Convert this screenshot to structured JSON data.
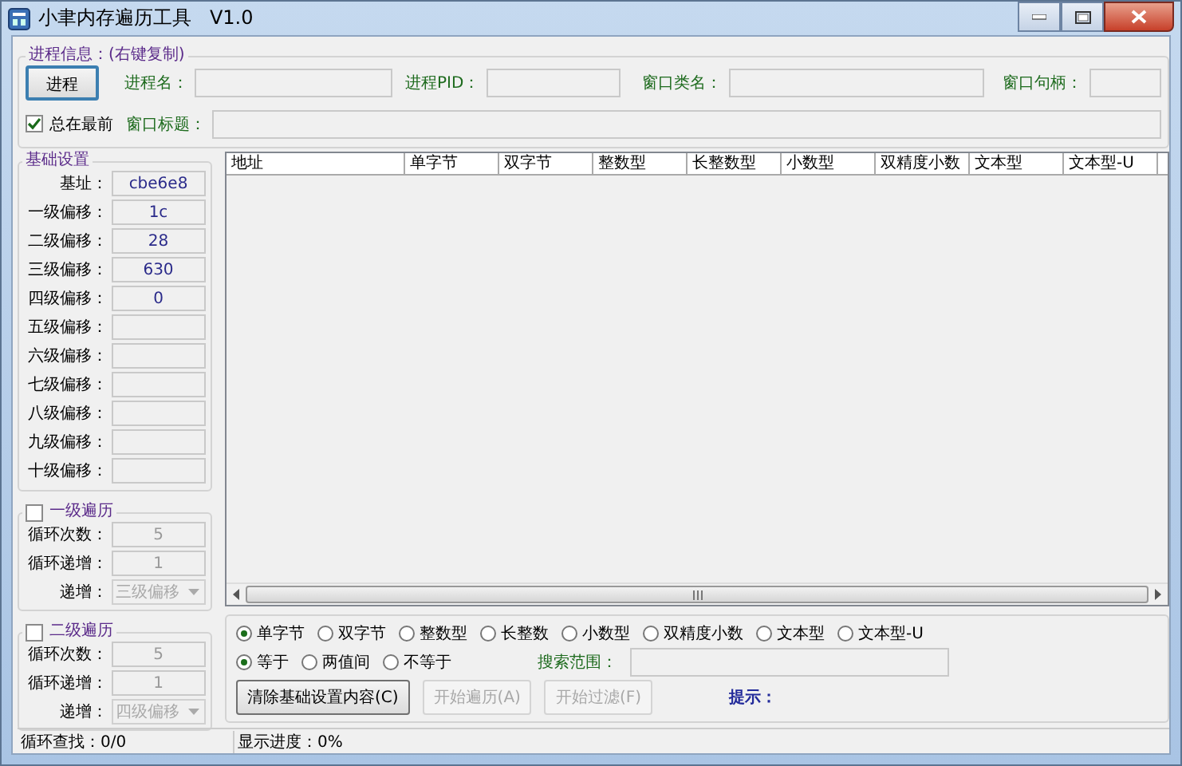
{
  "window": {
    "title": "小聿内存遍历工具   V1.0"
  },
  "process_info": {
    "legend": "进程信息：(右键复制)",
    "process_button": "进程",
    "fields": [
      {
        "label": "进程名："
      },
      {
        "label": "进程PID："
      },
      {
        "label": "窗口类名："
      },
      {
        "label": "窗口句柄："
      }
    ],
    "always_on_top": {
      "label": "总在最前",
      "checked": true
    },
    "window_title_field": {
      "label": "窗口标题："
    }
  },
  "base_settings": {
    "legend": "基础设置",
    "rows": [
      {
        "label": "基址：",
        "value": "cbe6e8"
      },
      {
        "label": "一级偏移：",
        "value": "1c"
      },
      {
        "label": "二级偏移：",
        "value": "28"
      },
      {
        "label": "三级偏移：",
        "value": "630"
      },
      {
        "label": "四级偏移：",
        "value": "0"
      },
      {
        "label": "五级偏移："
      },
      {
        "label": "六级偏移："
      },
      {
        "label": "七级偏移："
      },
      {
        "label": "八级偏移："
      },
      {
        "label": "九级偏移："
      },
      {
        "label": "十级偏移："
      }
    ]
  },
  "traversals": [
    {
      "legend": "一级遍历",
      "checked": false,
      "disabled": true,
      "fields": [
        {
          "label": "循环次数：",
          "value": "5"
        },
        {
          "label": "循环递增：",
          "value": "1"
        }
      ],
      "increment": {
        "label": "递增：",
        "value": "三级偏移"
      }
    },
    {
      "legend": "二级遍历",
      "checked": false,
      "disabled": true,
      "fields": [
        {
          "label": "循环次数：",
          "value": "5"
        },
        {
          "label": "循环递增：",
          "value": "1"
        }
      ],
      "increment": {
        "label": "递增：",
        "value": "四级偏移"
      }
    }
  ],
  "table": {
    "columns": [
      "地址",
      "单字节",
      "双字节",
      "整数型",
      "长整数型",
      "小数型",
      "双精度小数",
      "文本型",
      "文本型-U"
    ]
  },
  "data_types": [
    {
      "label": "单字节",
      "selected": true
    },
    {
      "label": "双字节",
      "selected": false
    },
    {
      "label": "整数型",
      "selected": false
    },
    {
      "label": "长整数",
      "selected": false
    },
    {
      "label": "小数型",
      "selected": false
    },
    {
      "label": "双精度小数",
      "selected": false
    },
    {
      "label": "文本型",
      "selected": false
    },
    {
      "label": "文本型-U",
      "selected": false
    }
  ],
  "comparisons": [
    {
      "label": "等于",
      "selected": true
    },
    {
      "label": "两值间",
      "selected": false
    },
    {
      "label": "不等于",
      "selected": false
    }
  ],
  "search_range": {
    "label": "搜索范围："
  },
  "buttons": [
    {
      "label": "清除基础设置内容(C)",
      "disabled": false
    },
    {
      "label": "开始遍历(A)",
      "disabled": true
    },
    {
      "label": "开始过滤(F)",
      "disabled": true
    }
  ],
  "hint": "提示：",
  "status_bar": [
    {
      "text": "循环查找：0/0"
    },
    {
      "text": "显示进度：0%"
    }
  ]
}
